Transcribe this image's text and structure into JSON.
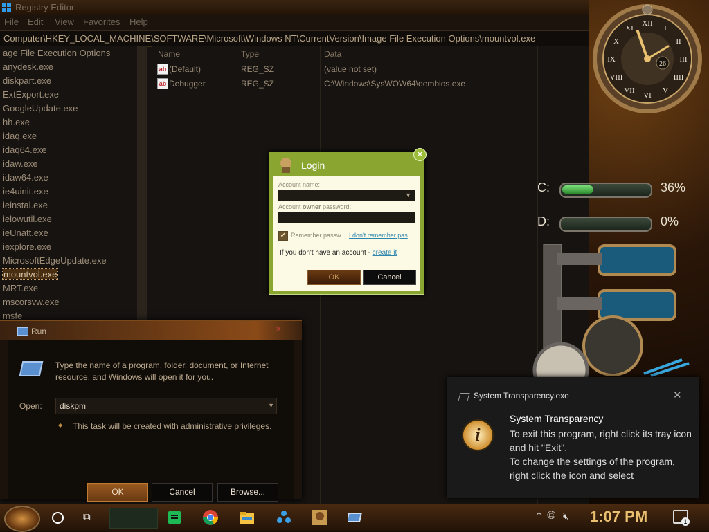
{
  "regedit": {
    "title": "Registry Editor",
    "menu": [
      "File",
      "Edit",
      "View",
      "Favorites",
      "Help"
    ],
    "address": "Computer\\HKEY_LOCAL_MACHINE\\SOFTWARE\\Microsoft\\Windows NT\\CurrentVersion\\Image File Execution Options\\mountvol.exe",
    "tree_items": [
      "age File Execution Options",
      "anydesk.exe",
      "diskpart.exe",
      "ExtExport.exe",
      "GoogleUpdate.exe",
      "hh.exe",
      "idaq.exe",
      "idaq64.exe",
      "idaw.exe",
      "idaw64.exe",
      "ie4uinit.exe",
      "ieinstal.exe",
      "ielowutil.exe",
      "ieUnatt.exe",
      "iexplore.exe",
      "MicrosoftEdgeUpdate.exe",
      "mountvol.exe",
      "MRT.exe",
      "mscorsvw.exe",
      "msfe"
    ],
    "columns": {
      "name": "Name",
      "type": "Type",
      "data": "Data"
    },
    "values": [
      {
        "icon": "ab",
        "name": "(Default)",
        "type": "REG_SZ",
        "data": "(value not set)"
      },
      {
        "icon": "ab",
        "name": "Debugger",
        "type": "REG_SZ",
        "data": "C:\\Windows\\SysWOW64\\oembios.exe"
      }
    ]
  },
  "clock": {
    "numerals": [
      "XII",
      "I",
      "II",
      "III",
      "IIII",
      "V",
      "VI",
      "VII",
      "VIII",
      "IX",
      "X",
      "XI"
    ],
    "date": "26"
  },
  "drives": [
    {
      "letter": "C:",
      "percent": "36%",
      "fill": 0.36
    },
    {
      "letter": "D:",
      "percent": "0%",
      "fill": 0.0
    }
  ],
  "login": {
    "title": "Login",
    "account_label": "Account name:",
    "password_label_pre": "Account ",
    "password_label_bold": "owner",
    "password_label_post": " password:",
    "remember": "Remember passw",
    "forgot": "I don't remember pas",
    "no_account": "If you don't have an account - ",
    "create": "create it",
    "ok": "OK",
    "cancel": "Cancel"
  },
  "run": {
    "title": "Run",
    "description": "Type the name of a program, folder, document, or Internet resource, and Windows will open it for you.",
    "open_label": "Open:",
    "input_value": "diskpm",
    "admin_note": "This task will be created with administrative privileges.",
    "ok": "OK",
    "cancel": "Cancel",
    "browse": "Browse..."
  },
  "toast": {
    "app_name": "System Transparency.exe",
    "heading": "System Transparency",
    "line1": "To exit this program, right click its tray icon and hit \"Exit\".",
    "line2": "To change the settings of the program, right click the icon and select"
  },
  "taskbar": {
    "time": "1:07 PM",
    "notification_count": "1",
    "apps": [
      "spotify-icon",
      "chrome-icon",
      "file-explorer-icon",
      "network-app-icon",
      "game-icon",
      "run-app-icon"
    ]
  },
  "colors": {
    "accent": "#8aa530",
    "clock_text": "#e8c070"
  }
}
